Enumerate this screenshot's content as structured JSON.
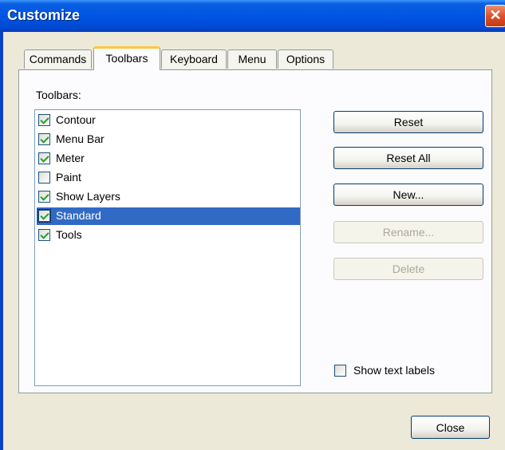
{
  "window": {
    "title": "Customize",
    "close_glyph": "✕"
  },
  "tabs": [
    {
      "label": "Commands"
    },
    {
      "label": "Toolbars",
      "active": true
    },
    {
      "label": "Keyboard"
    },
    {
      "label": "Menu"
    },
    {
      "label": "Options"
    }
  ],
  "toolbars": {
    "label": "Toolbars:",
    "items": [
      {
        "label": "Contour",
        "checked": true
      },
      {
        "label": "Menu Bar",
        "checked": true
      },
      {
        "label": "Meter",
        "checked": true
      },
      {
        "label": "Paint",
        "checked": false
      },
      {
        "label": "Show Layers",
        "checked": true
      },
      {
        "label": "Standard",
        "checked": true,
        "selected": true
      },
      {
        "label": "Tools",
        "checked": true
      }
    ]
  },
  "buttons": {
    "reset": "Reset",
    "reset_all": "Reset All",
    "new": "New...",
    "rename": "Rename...",
    "delete": "Delete",
    "close": "Close"
  },
  "show_text_labels": {
    "label": "Show text labels",
    "checked": false
  },
  "colors": {
    "selection": "#316ac5",
    "title_bar": "#0055e5",
    "tab_highlight": "#ffc83c"
  }
}
